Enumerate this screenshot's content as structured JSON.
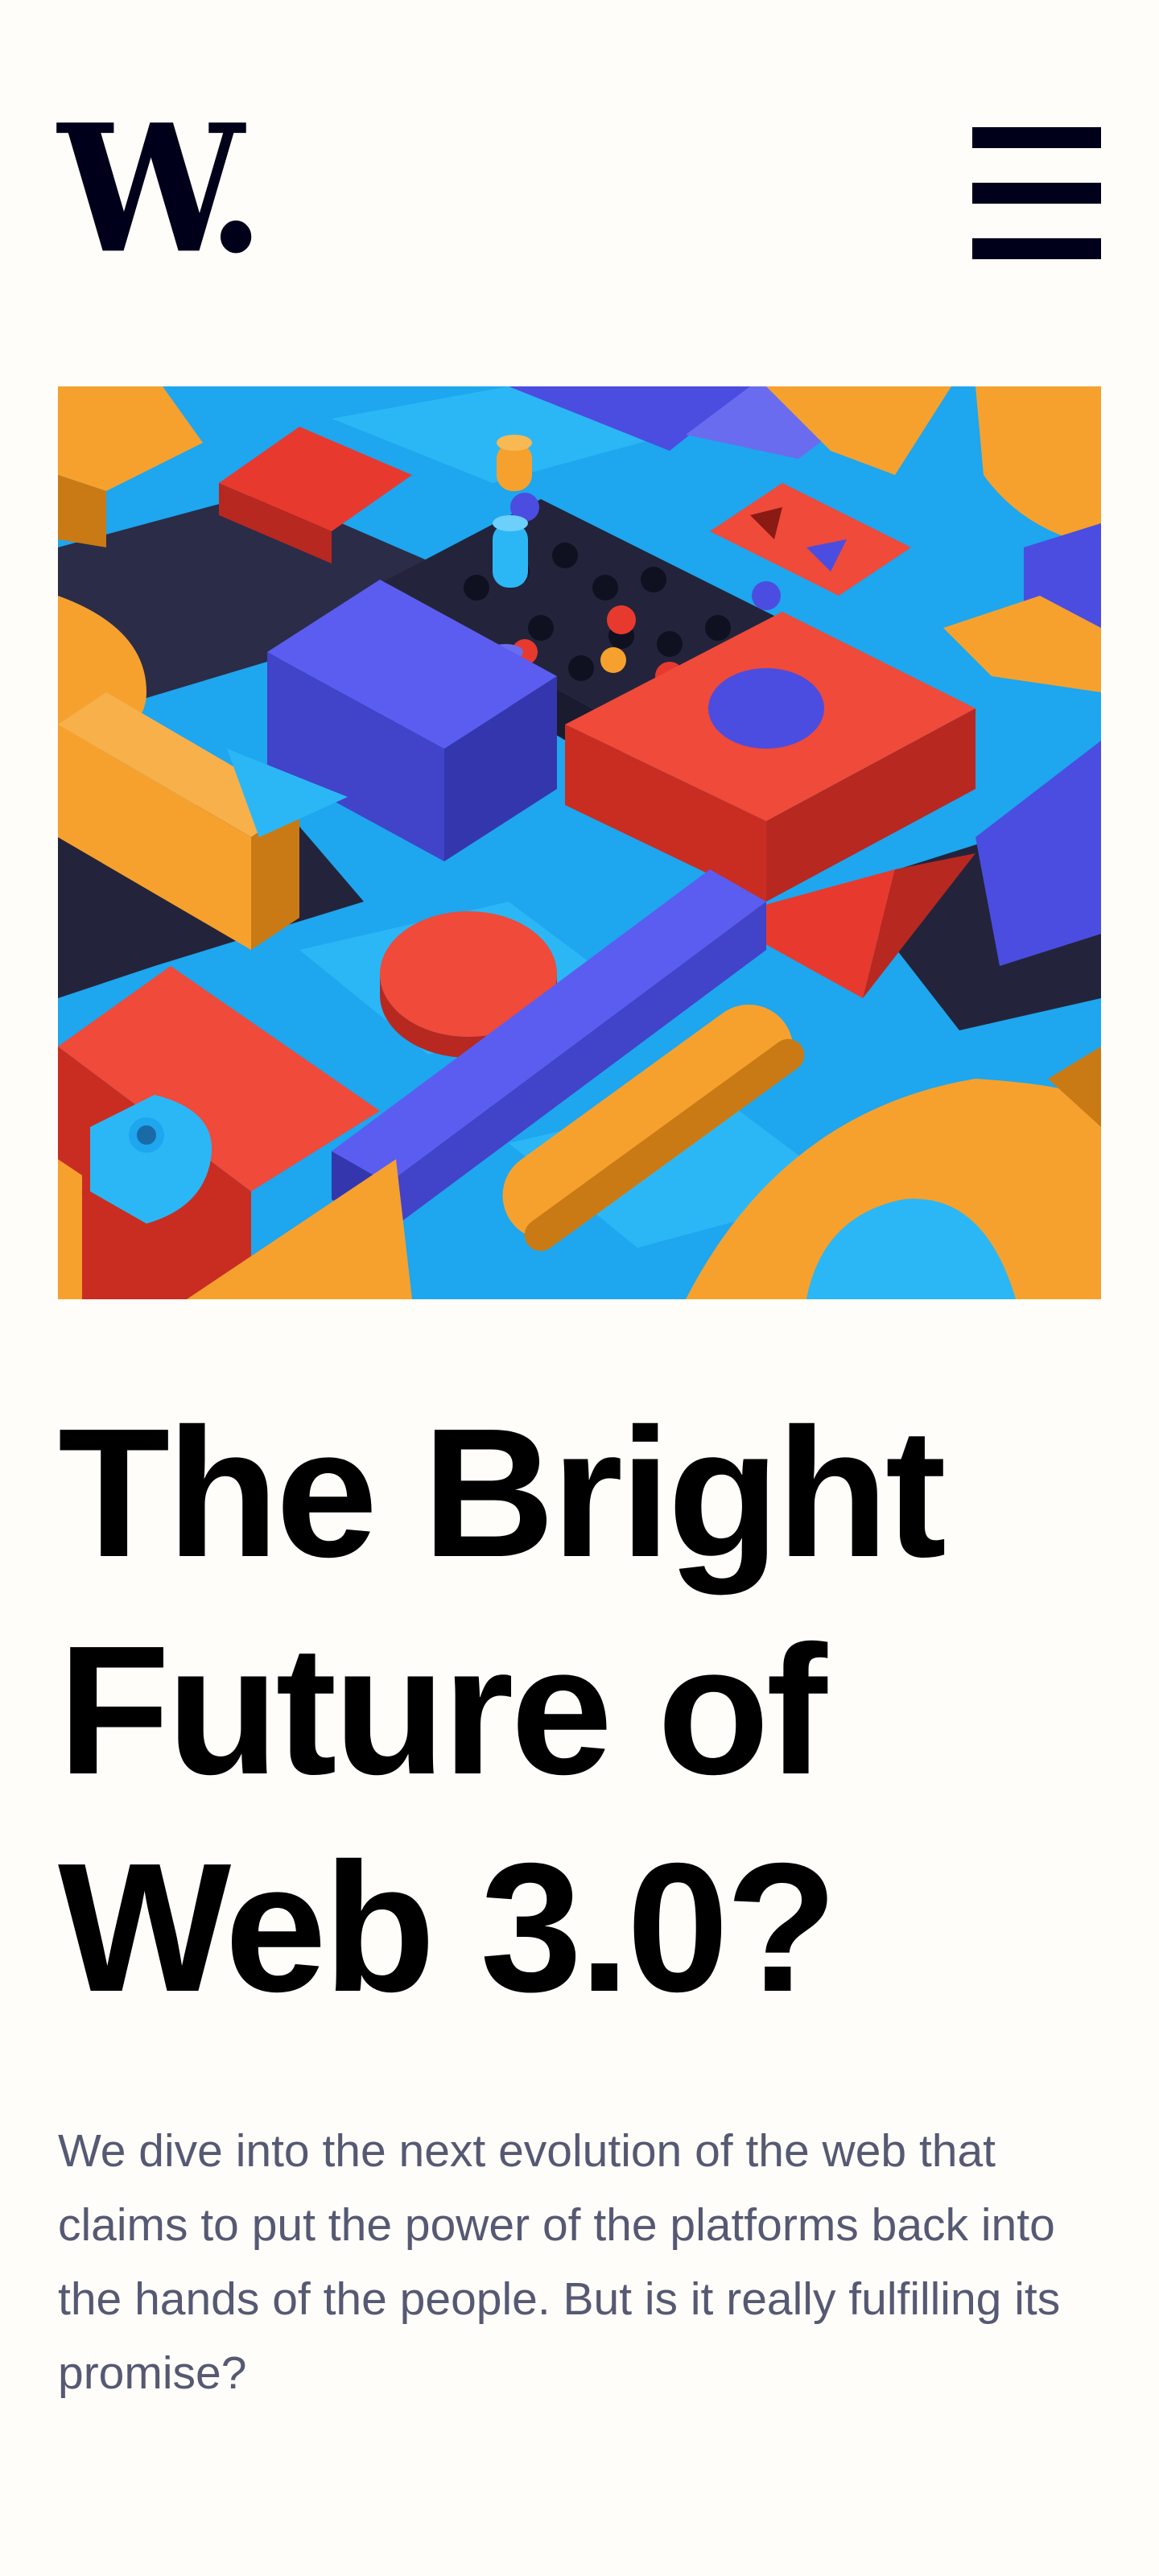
{
  "header": {
    "logo_text": "W.",
    "menu_icon": "hamburger-menu-icon"
  },
  "hero": {
    "image": "colorful-isometric-toy-blocks",
    "palette": [
      "#f6a12e",
      "#e8392f",
      "#4b4de0",
      "#1ea6ee",
      "#23243b"
    ]
  },
  "article": {
    "title_lines": [
      "The Bright",
      "Future of",
      "Web 3.0?"
    ],
    "lead": "We dive into the next evolution of the web that claims to put the power of the platforms back into the hands of the people. But is it really fulfilling its promise?"
  },
  "colors": {
    "background": "#fffdf9",
    "ink": "#00001a",
    "heading": "#000000",
    "body_text": "#565973"
  }
}
